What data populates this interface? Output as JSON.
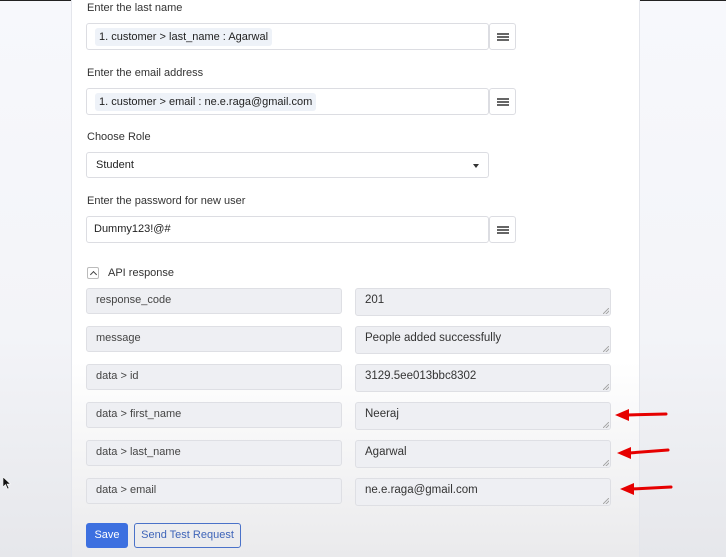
{
  "form": {
    "last_name": {
      "label": "Enter the last name",
      "chip": "1. customer > last_name : Agarwal"
    },
    "email": {
      "label": "Enter the email address",
      "chip": "1. customer > email : ne.e.raga@gmail.com"
    },
    "role": {
      "label": "Choose Role",
      "selected": "Student"
    },
    "password": {
      "label": "Enter the password for new user",
      "value": "Dummy123!@#"
    }
  },
  "api_response": {
    "title": "API response",
    "expanded": true,
    "rows": [
      {
        "key": "response_code",
        "value": "201"
      },
      {
        "key": "message",
        "value": "People added successfully"
      },
      {
        "key": "data > id",
        "value": "3129.5ee013bbc8302"
      },
      {
        "key": "data > first_name",
        "value": "Neeraj",
        "highlighted": true
      },
      {
        "key": "data > last_name",
        "value": "Agarwal",
        "highlighted": true
      },
      {
        "key": "data > email",
        "value": "ne.e.raga@gmail.com",
        "highlighted": true
      }
    ]
  },
  "actions": {
    "save_label": "Save",
    "test_label": "Send Test Request"
  },
  "colors": {
    "primary": "#3d70e0",
    "annotation_arrow": "#e60000"
  }
}
